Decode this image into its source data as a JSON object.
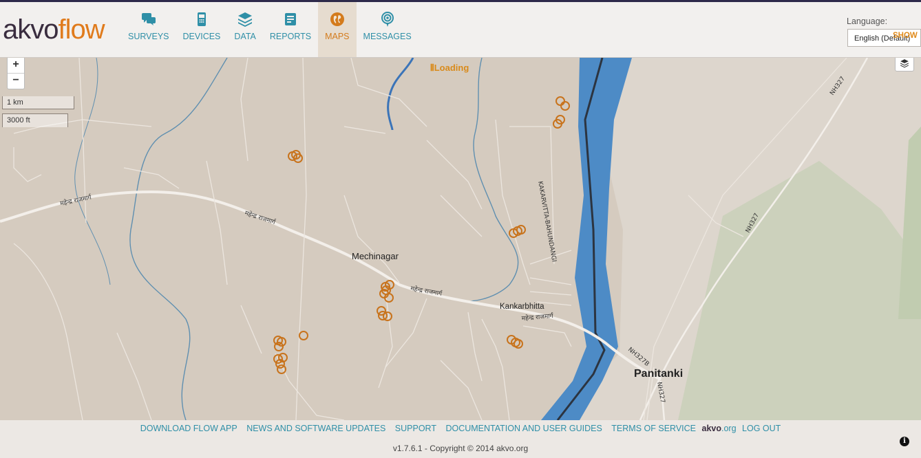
{
  "colors": {
    "brand_dark": "#3a2d3f",
    "brand_orange": "#e07b1c",
    "nav_teal": "#2f8fa7",
    "active_orange": "#d47b1c",
    "river": "#4d8bc6",
    "marker": "#c8731c"
  },
  "logo": {
    "part1": "akvo",
    "part2": "flow"
  },
  "nav": [
    {
      "label": "SURVEYS",
      "icon": "chat-bubbles-icon",
      "active": false
    },
    {
      "label": "DEVICES",
      "icon": "phone-icon",
      "active": false
    },
    {
      "label": "DATA",
      "icon": "layers-stack-icon",
      "active": false
    },
    {
      "label": "REPORTS",
      "icon": "report-book-icon",
      "active": false
    },
    {
      "label": "MAPS",
      "icon": "globe-icon",
      "active": true
    },
    {
      "label": "MESSAGES",
      "icon": "broadcast-pin-icon",
      "active": false
    }
  ],
  "language": {
    "label": "Language:",
    "selected": "English (Default)",
    "show": "SHOW"
  },
  "map": {
    "loading": "Loading",
    "zoom_in": "+",
    "zoom_out": "−",
    "scale_metric": "1 km",
    "scale_imperial": "3000 ft",
    "labels": {
      "mechinagar": "Mechinagar",
      "kankarbhitta": "Kankarbhitta",
      "panitanki": "Panitanki",
      "kakarvitta": "KAKARVITTA-BAHUNDANGI",
      "nh327a": "NH327",
      "nh327b": "NH327",
      "nh327c": "NH327",
      "nh327b2": "NH327B",
      "hw1": "महेन्द्र राजमार्ग",
      "hw2": "महेन्द्र राजमार्ग",
      "hw3": "महेन्द्र राजमार्ग",
      "hw4": "महेन्द्र राजमार्ग"
    }
  },
  "footer": {
    "links": [
      "DOWNLOAD FLOW APP",
      "NEWS AND SOFTWARE UPDATES",
      "SUPPORT",
      "DOCUMENTATION AND USER GUIDES",
      "TERMS OF SERVICE"
    ],
    "akvo": "akvo",
    "akvo_org": ".org",
    "logout": "LOG OUT",
    "copyright": "v1.7.6.1 - Copyright © 2014 akvo.org",
    "info": "i"
  }
}
